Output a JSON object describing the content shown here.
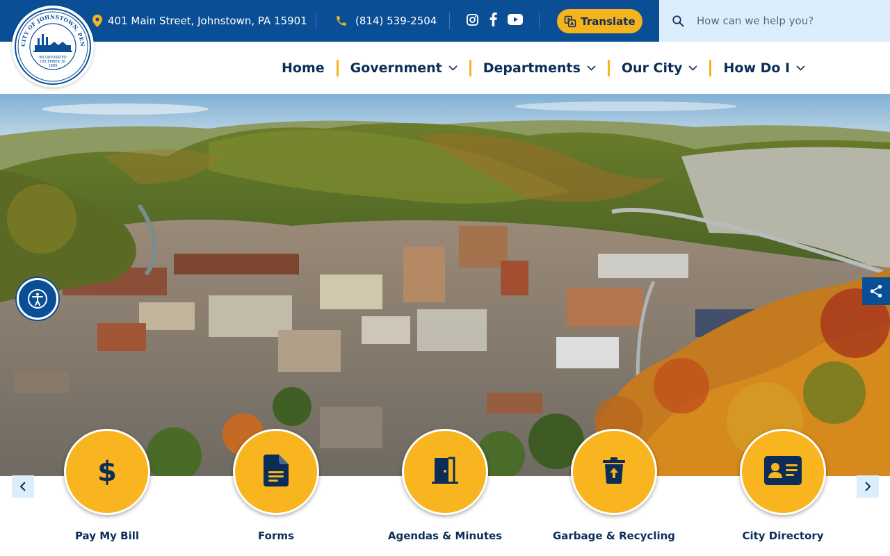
{
  "topbar": {
    "address": "401 Main Street, Johnstown, PA 15901",
    "phone": "(814) 539-2504",
    "social": [
      "instagram-icon",
      "facebook-icon",
      "youtube-icon"
    ],
    "translate_label": "Translate"
  },
  "search": {
    "placeholder": "How can we help you?"
  },
  "seal": {
    "top_text": "CITY OF JOHNSTOWN, PENNSYLVANIA",
    "line1": "INCORPORATED",
    "line2": "DECEMBER 18",
    "line3": "1889"
  },
  "nav": {
    "items": [
      {
        "label": "Home",
        "dropdown": false
      },
      {
        "label": "Government",
        "dropdown": true
      },
      {
        "label": "Departments",
        "dropdown": true
      },
      {
        "label": "Our City",
        "dropdown": true
      },
      {
        "label": "How Do I",
        "dropdown": true
      }
    ]
  },
  "quick_links": [
    {
      "label": "Pay My Bill",
      "icon": "dollar-icon"
    },
    {
      "label": "Forms",
      "icon": "document-icon"
    },
    {
      "label": "Agendas & Minutes",
      "icon": "door-icon"
    },
    {
      "label": "Garbage & Recycling",
      "icon": "trash-icon"
    },
    {
      "label": "City Directory",
      "icon": "id-card-icon"
    }
  ],
  "colors": {
    "primary_blue": "#0a4f96",
    "accent_gold": "#f5b41e",
    "navy_text": "#0b2d57",
    "search_bg": "#dcedfb"
  }
}
